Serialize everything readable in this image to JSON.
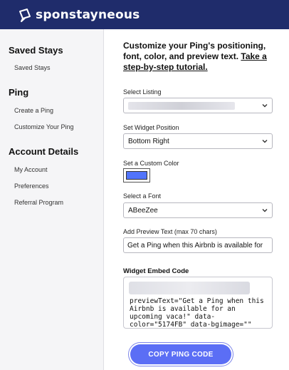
{
  "header": {
    "brand": "sponstayneous",
    "bg_color": "#1f2c6b"
  },
  "sidebar": {
    "sections": [
      {
        "heading": "Saved Stays",
        "items": [
          "Saved Stays"
        ]
      },
      {
        "heading": "Ping",
        "items": [
          "Create a Ping",
          "Customize Your Ping"
        ]
      },
      {
        "heading": "Account Details",
        "items": [
          "My Account",
          "Preferences",
          "Referral Program"
        ]
      }
    ]
  },
  "main": {
    "intro": "Customize your Ping's positioning, font, color, and preview text.",
    "tutorial_link": "Take a step-by-step tutorial.",
    "listing": {
      "label": "Select Listing"
    },
    "position": {
      "label": "Set Widget Position",
      "value": "Bottom Right"
    },
    "color": {
      "label": "Set a Custom Color",
      "value": "#5174FB"
    },
    "font": {
      "label": "Select a Font",
      "value": "ABeeZee"
    },
    "preview": {
      "label": "Add Preview Text (max 70 chars)",
      "value": "Get a Ping when this Airbnb is available for"
    },
    "embed": {
      "label": "Widget Embed Code",
      "code": "previewText=\"Get a Ping when this\nAirbnb is available for an\nupcoming vaca!\" data-\ncolor=\"5174FB\" data-bgimage=\"\""
    },
    "copy_button": "COPY PING CODE",
    "button_color": "#5b6ef5"
  }
}
